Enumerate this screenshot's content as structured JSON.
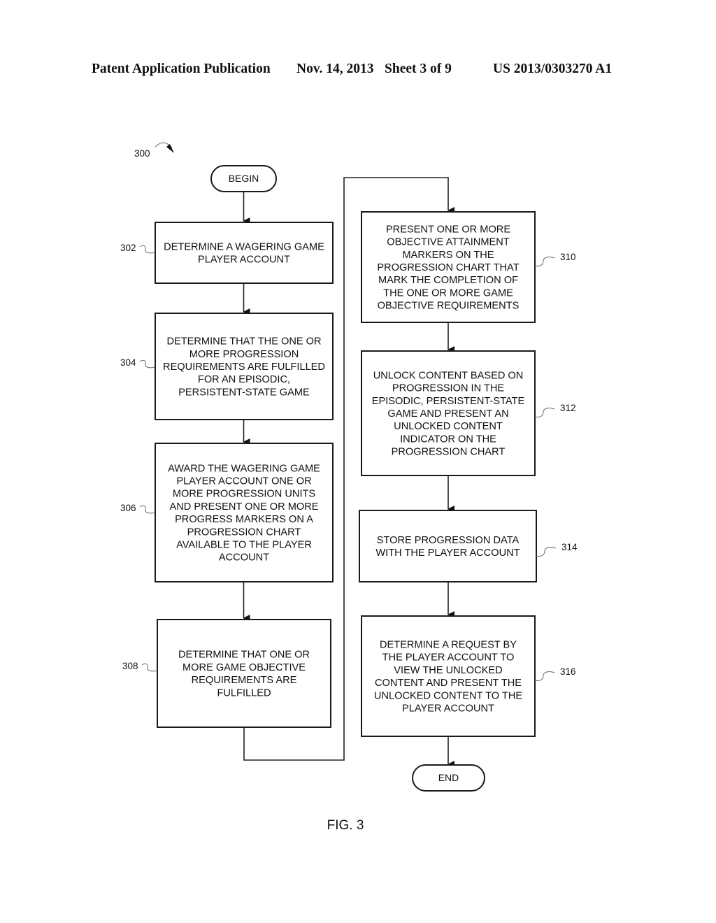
{
  "header": {
    "publication": "Patent Application Publication",
    "date": "Nov. 14, 2013",
    "sheet": "Sheet 3 of 9",
    "number": "US 2013/0303270 A1"
  },
  "figure": {
    "ref": "300",
    "caption": "FIG. 3",
    "begin": "BEGIN",
    "end": "END"
  },
  "steps": [
    {
      "ref": "302",
      "lines": [
        "DETERMINE A WAGERING GAME",
        "PLAYER ACCOUNT"
      ]
    },
    {
      "ref": "304",
      "lines": [
        "DETERMINE THAT THE ONE OR",
        "MORE PROGRESSION",
        "REQUIREMENTS ARE FULFILLED",
        "FOR AN EPISODIC,",
        "PERSISTENT-STATE GAME"
      ]
    },
    {
      "ref": "306",
      "lines": [
        "AWARD THE WAGERING GAME",
        "PLAYER ACCOUNT ONE OR",
        "MORE PROGRESSION UNITS",
        "AND PRESENT ONE OR MORE",
        "PROGRESS MARKERS ON A",
        "PROGRESSION CHART",
        "AVAILABLE TO THE PLAYER",
        "ACCOUNT"
      ]
    },
    {
      "ref": "308",
      "lines": [
        "DETERMINE THAT ONE OR",
        "MORE GAME OBJECTIVE",
        "REQUIREMENTS ARE",
        "FULFILLED"
      ]
    },
    {
      "ref": "310",
      "lines": [
        "PRESENT ONE OR MORE",
        "OBJECTIVE ATTAINMENT",
        "MARKERS ON THE",
        "PROGRESSION CHART THAT",
        "MARK THE COMPLETION OF",
        "THE ONE OR MORE GAME",
        "OBJECTIVE REQUIREMENTS"
      ]
    },
    {
      "ref": "312",
      "lines": [
        "UNLOCK CONTENT BASED ON",
        "PROGRESSION IN THE",
        "EPISODIC, PERSISTENT-STATE",
        "GAME AND PRESENT AN",
        "UNLOCKED CONTENT",
        "INDICATOR ON THE",
        "PROGRESSION CHART"
      ]
    },
    {
      "ref": "314",
      "lines": [
        "STORE PROGRESSION DATA",
        "WITH THE PLAYER ACCOUNT"
      ]
    },
    {
      "ref": "316",
      "lines": [
        "DETERMINE A REQUEST BY",
        "THE PLAYER ACCOUNT TO",
        "VIEW THE UNLOCKED",
        "CONTENT AND PRESENT THE",
        "UNLOCKED CONTENT TO THE",
        "PLAYER ACCOUNT"
      ]
    }
  ]
}
